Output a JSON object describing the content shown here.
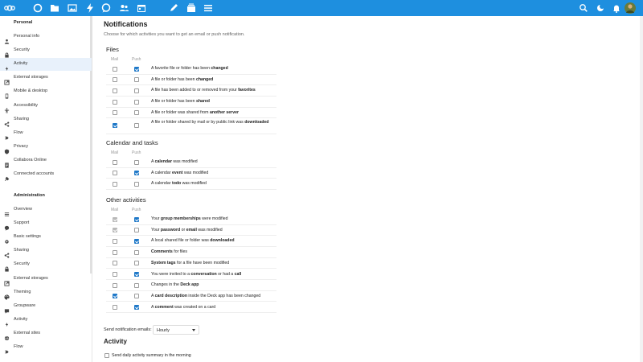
{
  "colors": {
    "header": "#1e8fdf",
    "check": "#1e78c8",
    "active_item": "#e8f1fb"
  },
  "header": {
    "app_icons": [
      "nextcloud-logo-icon",
      "dashboard-icon",
      "files-icon",
      "photos-icon",
      "activity-icon",
      "talk-icon",
      "contacts-icon",
      "calendar-icon",
      "notes-icon",
      "deck-icon",
      "tasks-icon"
    ],
    "right_icons": [
      "search-icon",
      "status-icon",
      "notifications-icon",
      "avatar"
    ]
  },
  "sidebar": {
    "personal_title": "Personal",
    "personal": [
      {
        "label": "Personal info",
        "icon": "person-icon"
      },
      {
        "label": "Security",
        "icon": "lock-icon"
      },
      {
        "label": "Activity",
        "icon": "activity-icon"
      },
      {
        "label": "External storages",
        "icon": "external-storage-icon"
      },
      {
        "label": "Mobile & desktop",
        "icon": "mobile-icon"
      },
      {
        "label": "Accessibility",
        "icon": "accessibility-icon"
      },
      {
        "label": "Sharing",
        "icon": "share-icon"
      },
      {
        "label": "Flow",
        "icon": "flow-icon"
      },
      {
        "label": "Privacy",
        "icon": "privacy-icon"
      },
      {
        "label": "Collabora Online",
        "icon": "collabora-icon"
      },
      {
        "label": "Connected accounts",
        "icon": "connected-accounts-icon"
      }
    ],
    "admin_title": "Administration",
    "admin": [
      {
        "label": "Overview",
        "icon": "overview-icon"
      },
      {
        "label": "Support",
        "icon": "support-icon"
      },
      {
        "label": "Basic settings",
        "icon": "settings-icon"
      },
      {
        "label": "Sharing",
        "icon": "share-icon"
      },
      {
        "label": "Security",
        "icon": "lock-icon"
      },
      {
        "label": "External storages",
        "icon": "external-storage-icon"
      },
      {
        "label": "Theming",
        "icon": "theming-icon"
      },
      {
        "label": "Groupware",
        "icon": "groupware-icon"
      },
      {
        "label": "Activity",
        "icon": "activity-icon"
      },
      {
        "label": "External sites",
        "icon": "external-sites-icon"
      },
      {
        "label": "Flow",
        "icon": "flow-icon"
      }
    ],
    "active_index": 2
  },
  "main": {
    "title": "Notifications",
    "description": "Choose for which activities you want to get an email or push notification.",
    "mail_label": "Mail",
    "push_label": "Push",
    "sections": [
      {
        "title": "Files",
        "rows": [
          {
            "mail": false,
            "push": true,
            "parts": [
              [
                "A favorite file or folder has been ",
                false
              ],
              [
                "changed",
                true
              ]
            ]
          },
          {
            "mail": false,
            "push": false,
            "parts": [
              [
                "A file or folder has been ",
                false
              ],
              [
                "changed",
                true
              ]
            ]
          },
          {
            "mail": false,
            "push": false,
            "parts": [
              [
                "A file has been added to or removed from your ",
                false
              ],
              [
                "favorites",
                true
              ]
            ]
          },
          {
            "mail": false,
            "push": false,
            "parts": [
              [
                "A file or folder has been ",
                false
              ],
              [
                "shared",
                true
              ]
            ]
          },
          {
            "mail": false,
            "push": false,
            "parts": [
              [
                "A file or folder was shared from ",
                false
              ],
              [
                "another server",
                true
              ]
            ]
          },
          {
            "mail": true,
            "push": false,
            "tall": true,
            "parts": [
              [
                "A file or folder shared by mail or by public link was ",
                false
              ],
              [
                "downloaded",
                true
              ]
            ]
          }
        ]
      },
      {
        "title": "Calendar and tasks",
        "rows": [
          {
            "mail": false,
            "push": false,
            "parts": [
              [
                "A ",
                false
              ],
              [
                "calendar",
                true
              ],
              [
                " was modified",
                false
              ]
            ]
          },
          {
            "mail": false,
            "push": true,
            "parts": [
              [
                "A calendar ",
                false
              ],
              [
                "event",
                true
              ],
              [
                " was modified",
                false
              ]
            ]
          },
          {
            "mail": false,
            "push": false,
            "parts": [
              [
                "A calendar ",
                false
              ],
              [
                "todo",
                true
              ],
              [
                " was modified",
                false
              ]
            ]
          }
        ]
      },
      {
        "title": "Other activities",
        "rows": [
          {
            "mail": true,
            "mail_disabled": true,
            "push": true,
            "parts": [
              [
                "Your ",
                false
              ],
              [
                "group memberships",
                true
              ],
              [
                " were modified",
                false
              ]
            ]
          },
          {
            "mail": true,
            "mail_disabled": true,
            "push": false,
            "parts": [
              [
                "Your ",
                false
              ],
              [
                "password",
                true
              ],
              [
                " or ",
                false
              ],
              [
                "email",
                true
              ],
              [
                " was modified",
                false
              ]
            ]
          },
          {
            "mail": false,
            "push": true,
            "parts": [
              [
                "A local shared file or folder was ",
                false
              ],
              [
                "downloaded",
                true
              ]
            ]
          },
          {
            "mail": false,
            "push": false,
            "parts": [
              [
                "Comments",
                true
              ],
              [
                " for files",
                false
              ]
            ]
          },
          {
            "mail": false,
            "push": false,
            "parts": [
              [
                "System tags",
                true
              ],
              [
                " for a file have been modified",
                false
              ]
            ]
          },
          {
            "mail": false,
            "push": true,
            "parts": [
              [
                "You were invited to a ",
                false
              ],
              [
                "conversation",
                true
              ],
              [
                " or had a ",
                false
              ],
              [
                "call",
                true
              ]
            ]
          },
          {
            "mail": false,
            "push": false,
            "parts": [
              [
                "Changes in the ",
                false
              ],
              [
                "Deck app",
                true
              ]
            ]
          },
          {
            "mail": true,
            "push": false,
            "parts": [
              [
                "A ",
                false
              ],
              [
                "card description",
                true
              ],
              [
                " inside the Deck app has been changed",
                false
              ]
            ]
          },
          {
            "mail": false,
            "push": true,
            "parts": [
              [
                "A ",
                false
              ],
              [
                "comment",
                true
              ],
              [
                " was created on a card",
                false
              ]
            ]
          }
        ]
      }
    ],
    "send_label": "Send notification emails:",
    "send_value": "Hourly",
    "activity_title": "Activity",
    "daily_label": "Send daily activity summary in the morning"
  }
}
